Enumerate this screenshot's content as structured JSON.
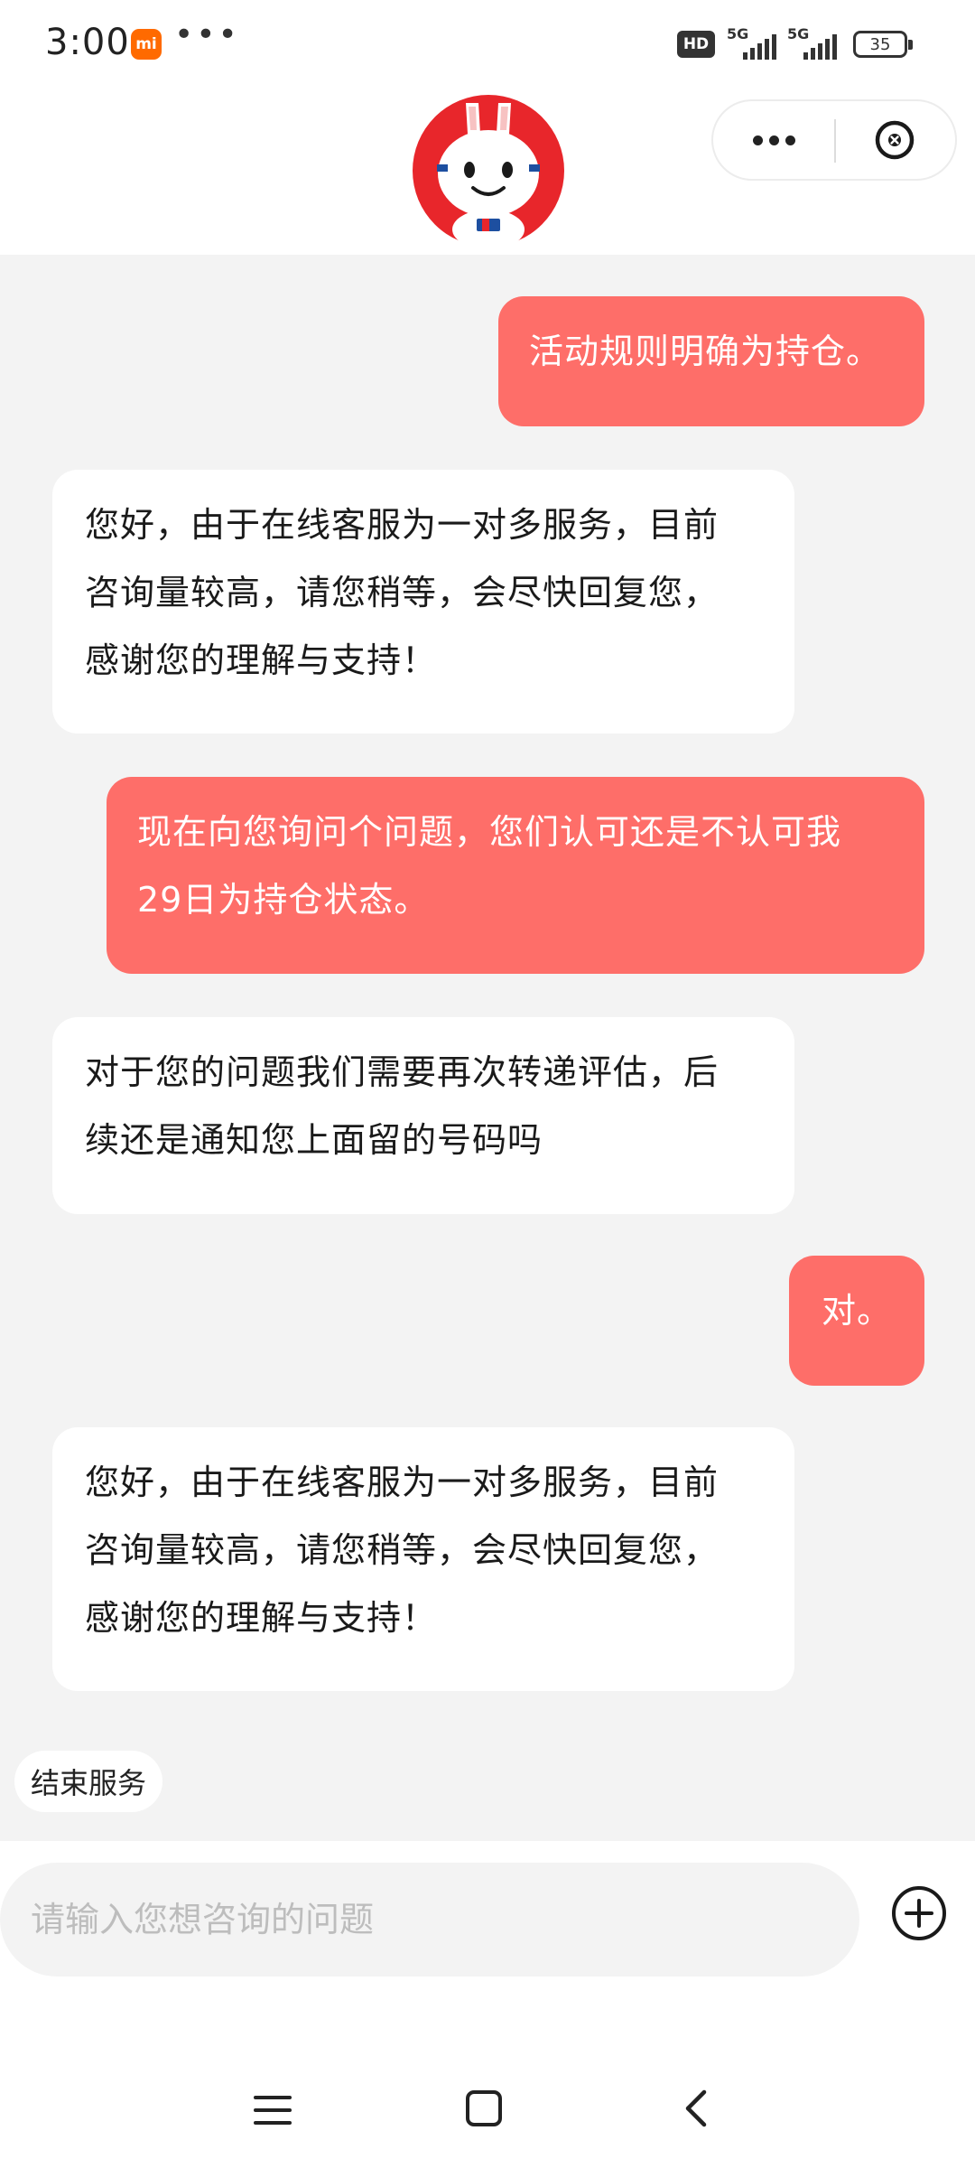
{
  "status_bar": {
    "time": "3:00",
    "brand_badge": "mi",
    "more": "•••",
    "hd": "HD",
    "signal_1": "5G",
    "signal_2": "5G",
    "battery": "35"
  },
  "header": {
    "avatar_icon": "rabbit-mascot-icon",
    "more_icon": "more-dots-icon",
    "close_icon": "close-circle-icon"
  },
  "messages": [
    {
      "role": "user",
      "text": "活动规则明确为持仓。"
    },
    {
      "role": "agent",
      "text": "您好，由于在线客服为一对多服务，目前\n咨询量较高，请您稍等，会尽快回复您，\n感谢您的理解与支持！"
    },
    {
      "role": "user",
      "text": "现在向您询问个问题，您们认可还是不认可我\n29日为持仓状态。"
    },
    {
      "role": "agent",
      "text": "对于您的问题我们需要再次转递评估，后\n续还是通知您上面留的号码吗"
    },
    {
      "role": "user",
      "text": "对。"
    },
    {
      "role": "agent",
      "text": "您好，由于在线客服为一对多服务，目前\n咨询量较高，请您稍等，会尽快回复您，\n感谢您的理解与支持！"
    }
  ],
  "actions": {
    "end_service": "结束服务"
  },
  "input": {
    "placeholder": "请输入您想咨询的问题",
    "value": "",
    "plus_icon": "plus-circle-icon"
  },
  "nav": {
    "menu_icon": "menu-icon",
    "home_icon": "home-square-icon",
    "back_icon": "back-chevron-icon"
  },
  "colors": {
    "user_bubble": "#fe6e69",
    "agent_bubble": "#ffffff",
    "background": "#f3f3f3",
    "mascot_red": "#e8262b"
  }
}
